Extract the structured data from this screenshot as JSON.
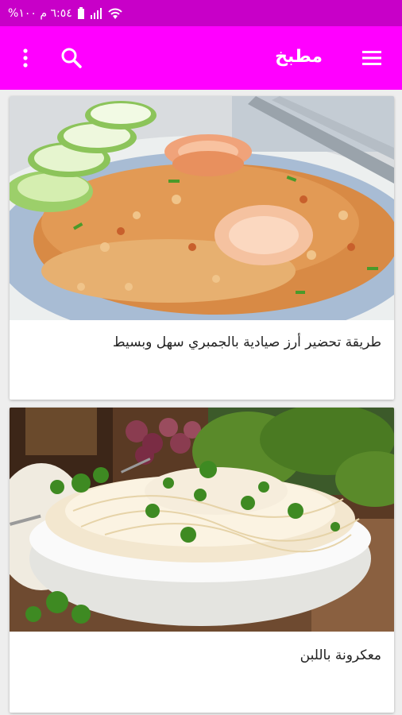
{
  "status_bar": {
    "text": "٦:٥٤ م ١٠٠%",
    "icons": [
      "battery-icon",
      "signal-icon",
      "wifi-icon"
    ]
  },
  "app_bar": {
    "title": "مطبخ",
    "background": "#ff00ff",
    "icons": [
      "menu-icon",
      "search-icon",
      "more-vert-icon"
    ]
  },
  "recipes": [
    {
      "title": "طريقة تحضير أرز صيادية بالجمبري سهل وبسيط",
      "image": "shrimp-rice-photo"
    },
    {
      "title": "معكرونة باللبن",
      "image": "pasta-with-milk-photo"
    }
  ],
  "colors": {
    "status_bar": "#c800c8",
    "app_bar": "#ff00ff",
    "background": "#eeeeee",
    "card": "#ffffff"
  }
}
